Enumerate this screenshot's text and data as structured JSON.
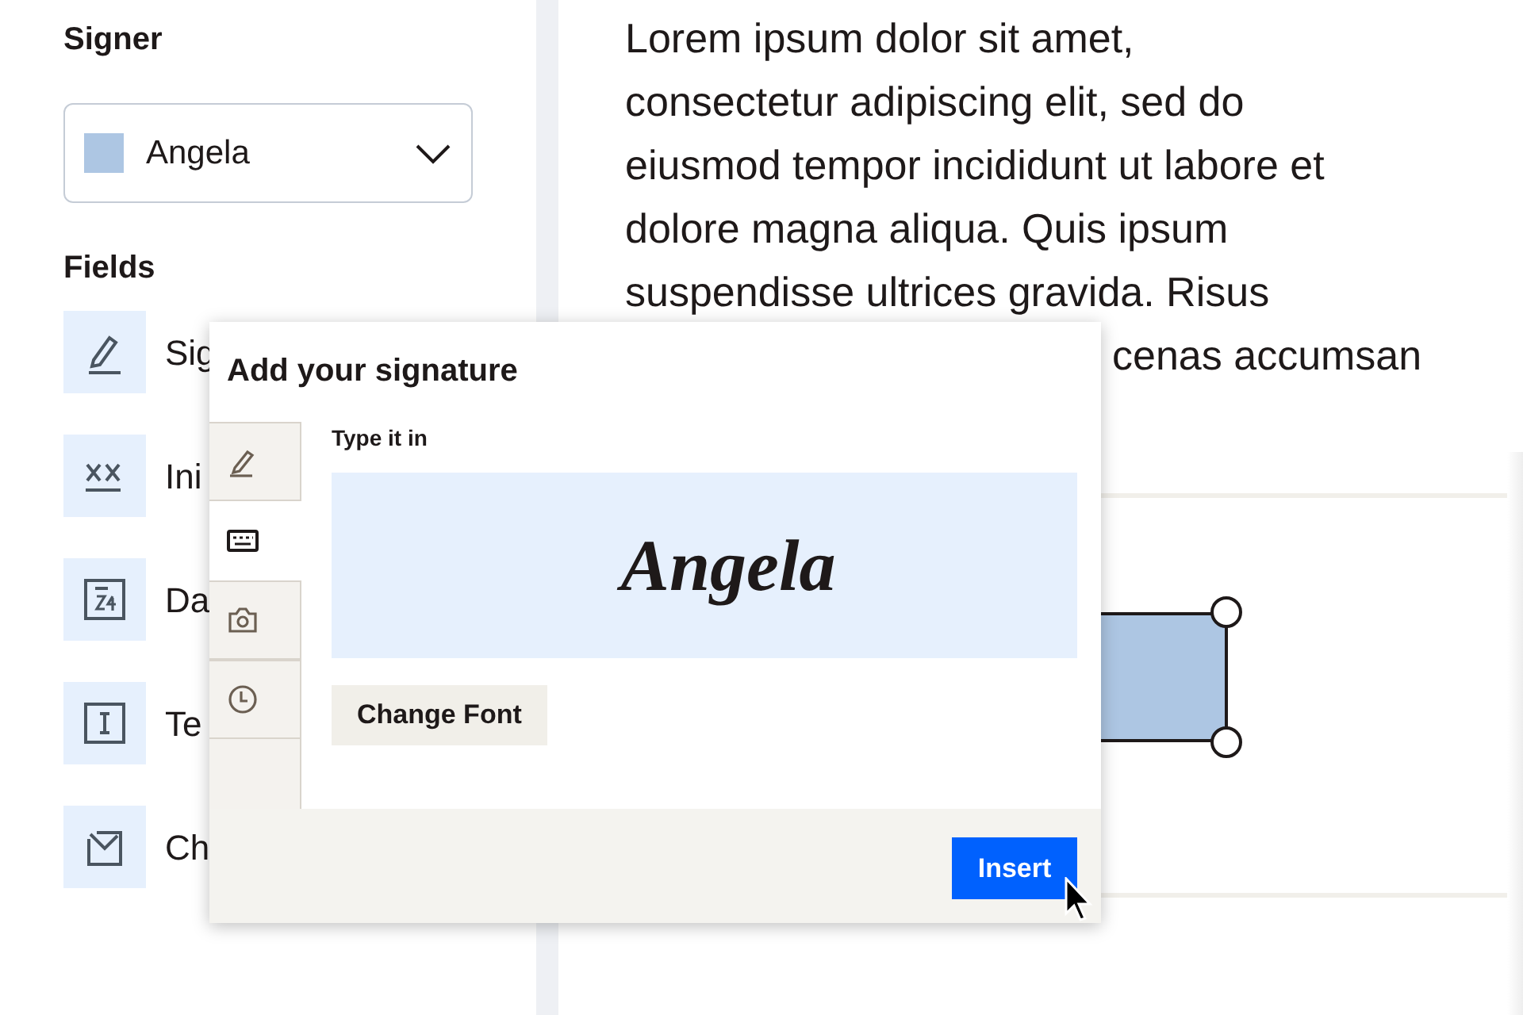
{
  "sidebar": {
    "signer_heading": "Signer",
    "signer": {
      "name": "Angela"
    },
    "fields_heading": "Fields",
    "fields": [
      {
        "kind": "signature",
        "label": "Sig"
      },
      {
        "kind": "initials",
        "label": "Ini"
      },
      {
        "kind": "date",
        "label": "Da"
      },
      {
        "kind": "text",
        "label": "Te"
      },
      {
        "kind": "checkbox",
        "label": "Ch"
      }
    ]
  },
  "document": {
    "paragraph_lines": [
      "Lorem ipsum dolor sit amet,",
      "consectetur adipiscing elit, sed do",
      "eiusmod tempor incididunt ut labore et",
      "dolore magna aliqua. Quis ipsum",
      "suspendisse ultrices gravida. Risus"
    ],
    "paragraph_tail": "cenas accumsan"
  },
  "dialog": {
    "title": "Add your signature",
    "tabs": [
      {
        "kind": "draw",
        "selected": false
      },
      {
        "kind": "type",
        "selected": true
      },
      {
        "kind": "photo",
        "selected": false
      },
      {
        "kind": "recent",
        "selected": false
      }
    ],
    "section_label": "Type it in",
    "signature": "Angela",
    "change_font": "Change Font",
    "insert": "Insert"
  }
}
